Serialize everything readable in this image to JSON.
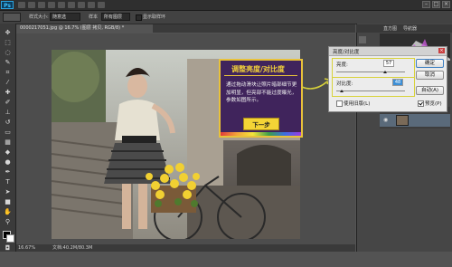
{
  "app": {
    "logo": "Ps"
  },
  "optionsbar": {
    "size_label": "样式大小:",
    "size_value": "随意选",
    "item2_label": "样本",
    "item3_value": "所有图层",
    "item4_label": "显示取样环"
  },
  "document": {
    "tab_title": "0000217051.jpg @ 16.7% (图层 拷贝, RGB/8) *"
  },
  "statusbar": {
    "zoom": "16.67%",
    "doc_info": "文档:40.2M/80.3M"
  },
  "tutorial": {
    "title": "调整亮度/对比度",
    "body": "通过拖动滑块让照片暗部细节更加明显，但亮部不能过度曝光，参数如图所示。",
    "next_label": "下一步",
    "accent_color": "#f3d23a",
    "bg_color": "#40245c"
  },
  "panels": {
    "tabs": [
      "直方图",
      "导航器"
    ]
  },
  "dialog": {
    "title": "亮度/对比度",
    "brightness_label": "亮度:",
    "brightness_value": "57",
    "contrast_label": "对比度:",
    "contrast_value": "48",
    "legacy_label": "使用旧版(L)",
    "preview_label": "预览(P)",
    "ok_label": "确定",
    "cancel_label": "取消",
    "auto_label": "自动(A)"
  }
}
